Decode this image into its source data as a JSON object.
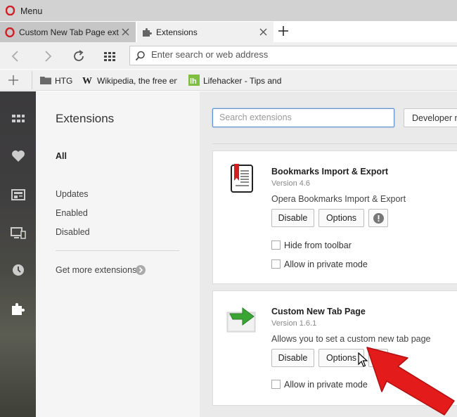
{
  "window": {
    "menu_label": "Menu"
  },
  "tabs": [
    {
      "label": "Custom New Tab Page extension",
      "icon": "opera-icon",
      "active": false
    },
    {
      "label": "Extensions",
      "icon": "puzzle-icon",
      "active": true
    }
  ],
  "address_bar": {
    "placeholder": "Enter search or web address",
    "value": ""
  },
  "bookmarks": [
    {
      "label": "HTG",
      "icon": "folder-icon"
    },
    {
      "label": "Wikipedia, the free encyclopedia",
      "icon": "wikipedia-icon"
    },
    {
      "label": "Lifehacker - Tips and downloads",
      "icon": "lifehacker-icon"
    }
  ],
  "sidebar": [
    "speed-dial-icon",
    "heart-icon",
    "news-icon",
    "devices-icon",
    "history-icon",
    "extensions-icon"
  ],
  "extensions_page": {
    "title": "Extensions",
    "nav": {
      "all": "All",
      "updates": "Updates",
      "enabled": "Enabled",
      "disabled": "Disabled"
    },
    "get_more": "Get more extensions",
    "search_placeholder": "Search extensions",
    "developer_mode": "Developer mode"
  },
  "extensions": [
    {
      "name": "Bookmarks Import & Export",
      "version": "Version 4.6",
      "description": "Opera Bookmarks Import & Export",
      "disable_label": "Disable",
      "options_label": "Options",
      "hide_toolbar": "Hide from toolbar",
      "private_mode": "Allow in private mode"
    },
    {
      "name": "Custom New Tab Page",
      "version": "Version 1.6.1",
      "description": "Allows you to set a custom new tab page",
      "disable_label": "Disable",
      "options_label": "Options",
      "private_mode": "Allow in private mode"
    }
  ],
  "colors": {
    "accent": "#5b8fd0",
    "arrow": "#e31b1b",
    "opera_red": "#d01f26"
  }
}
